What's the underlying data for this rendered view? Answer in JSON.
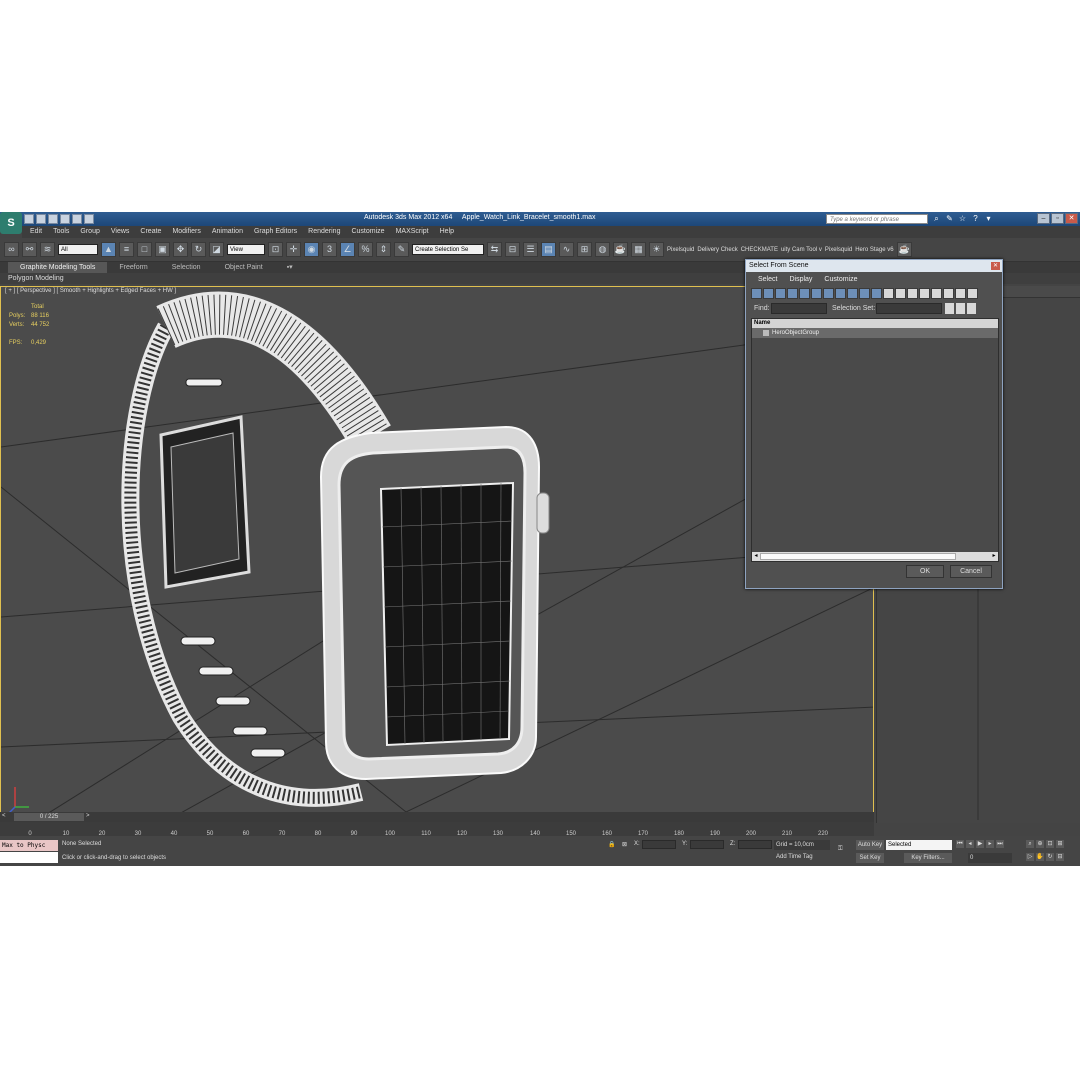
{
  "window": {
    "app_title": "Autodesk 3ds Max  2012 x64",
    "file_name": "Apple_Watch_Link_Bracelet_smooth1.max",
    "search_placeholder": "Type a keyword or phrase",
    "logo": "3ds-max-logo"
  },
  "menu": [
    "Edit",
    "Tools",
    "Group",
    "Views",
    "Create",
    "Modifiers",
    "Animation",
    "Graph Editors",
    "Rendering",
    "Customize",
    "MAXScript",
    "Help"
  ],
  "toolbar": {
    "filter_value": "All",
    "coord_value": "View",
    "selection_set_value": "Create Selection Se",
    "plugin_labels": [
      "Pixelsquid",
      "Delivery Check",
      "CHECKMATE",
      "uity Cam Tool v",
      "Pixelsquid",
      "Hero Stage v6"
    ]
  },
  "ribbon": {
    "tabs": [
      "Graphite Modeling Tools",
      "Freeform",
      "Selection",
      "Object Paint"
    ],
    "panel_label": "Polygon Modeling"
  },
  "viewport": {
    "label": "[ + ] [ Perspective ] [ Smooth + Highlights + Edged Faces + HW ]",
    "stats_header": "Total",
    "polys_label": "Polys:",
    "polys_value": "88 116",
    "verts_label": "Verts:",
    "verts_value": "44 752",
    "fps_label": "FPS:",
    "fps_value": "0,429"
  },
  "timeline": {
    "slider_label": "0 / 225",
    "ticks": [
      "0",
      "10",
      "20",
      "30",
      "40",
      "50",
      "60",
      "70",
      "80",
      "90",
      "100",
      "110",
      "120",
      "130",
      "140",
      "150",
      "160",
      "170",
      "180",
      "190",
      "200",
      "210",
      "220"
    ]
  },
  "status": {
    "maxscript_label": "Max to Physc",
    "selection_text": "None Selected",
    "prompt_text": "Click or click-and-drag to select objects",
    "x_label": "X:",
    "y_label": "Y:",
    "z_label": "Z:",
    "grid_text": "Grid = 10,0cm",
    "add_time_tag": "Add Time Tag",
    "auto_key": "Auto Key",
    "set_key": "Set Key",
    "selected_value": "Selected",
    "key_filters": "Key Filters...",
    "frame_value": "0"
  },
  "dialog": {
    "title": "Select From Scene",
    "menu": [
      "Select",
      "Display",
      "Customize"
    ],
    "find_label": "Find:",
    "selection_set_label": "Selection Set:",
    "column_header": "Name",
    "items": [
      "HeroObjectGroup"
    ],
    "ok_label": "OK",
    "cancel_label": "Cancel"
  },
  "colors": {
    "titlebar": "#2f5d92",
    "viewport_bg": "#4b4b4b",
    "active_viewport_border": "#e0c050",
    "stats_text": "#e8d060"
  }
}
